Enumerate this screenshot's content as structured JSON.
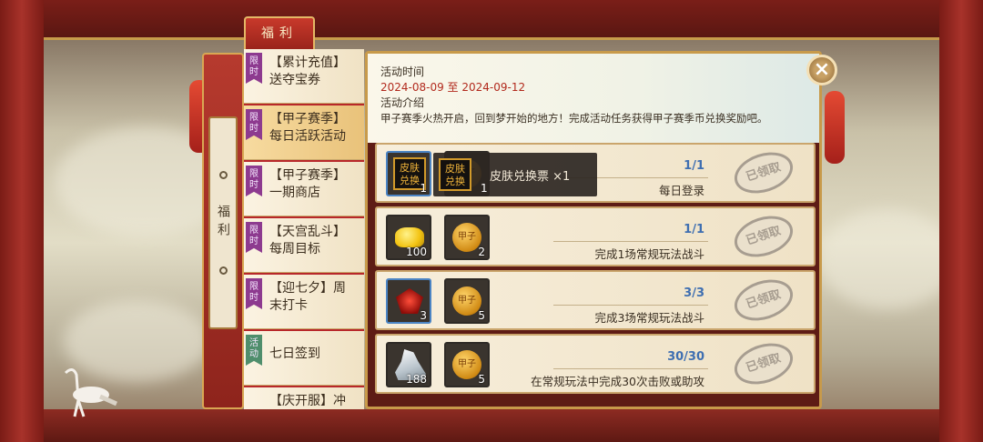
{
  "side_tab": {
    "label": "福利"
  },
  "header": {
    "title": "福利"
  },
  "menu": {
    "items": [
      {
        "tag": "限时",
        "line1": "【累计充值】",
        "line2": "送夺宝券",
        "active": false
      },
      {
        "tag": "限时",
        "line1": "【甲子赛季】",
        "line2": "每日活跃活动",
        "active": true
      },
      {
        "tag": "限时",
        "line1": "【甲子赛季】",
        "line2": "一期商店",
        "active": false
      },
      {
        "tag": "限时",
        "line1": "【天宫乱斗】",
        "line2": "每周目标",
        "active": false
      },
      {
        "tag": "限时",
        "line1": "【迎七夕】周",
        "line2": "末打卡",
        "active": false
      },
      {
        "tag": "活动",
        "line1": "七日签到",
        "line2": "",
        "active": false
      },
      {
        "tag": "",
        "line1": "【庆开服】冲",
        "line2": "",
        "active": false
      }
    ]
  },
  "info": {
    "time_label": "活动时间",
    "dates": "2024-08-09 至 2024-09-12",
    "intro_label": "活动介绍",
    "intro_text": "甲子赛季火热开启，回到梦开始的地方！完成活动任务获得甲子赛季币兑换奖励吧。"
  },
  "close_icon": "×",
  "tasks": [
    {
      "items": [
        {
          "type": "skin-ticket",
          "icon_text": "皮肤兑换",
          "count": "1"
        },
        {
          "type": "coin",
          "icon_text": "甲子",
          "count": ""
        }
      ],
      "progress": "1/1",
      "description": "每日登录",
      "status": "已领取"
    },
    {
      "items": [
        {
          "type": "gold-ingot",
          "icon_text": "",
          "count": "100"
        },
        {
          "type": "coin",
          "icon_text": "甲子",
          "count": "2"
        }
      ],
      "progress": "1/1",
      "description": "完成1场常规玩法战斗",
      "status": "已领取"
    },
    {
      "items": [
        {
          "type": "gem",
          "icon_text": "",
          "count": "3"
        },
        {
          "type": "coin",
          "icon_text": "甲子",
          "count": "5"
        }
      ],
      "progress": "3/3",
      "description": "完成3场常规玩法战斗",
      "status": "已领取"
    },
    {
      "items": [
        {
          "type": "stone",
          "icon_text": "",
          "count": "188"
        },
        {
          "type": "coin",
          "icon_text": "甲子",
          "count": "5"
        }
      ],
      "progress": "30/30",
      "description": "在常规玩法中完成30次击败或助攻",
      "status": "已领取"
    }
  ],
  "tooltip": {
    "icon_text": "皮肤兑换",
    "count": "1",
    "text": "皮肤兑换票 ×1"
  }
}
